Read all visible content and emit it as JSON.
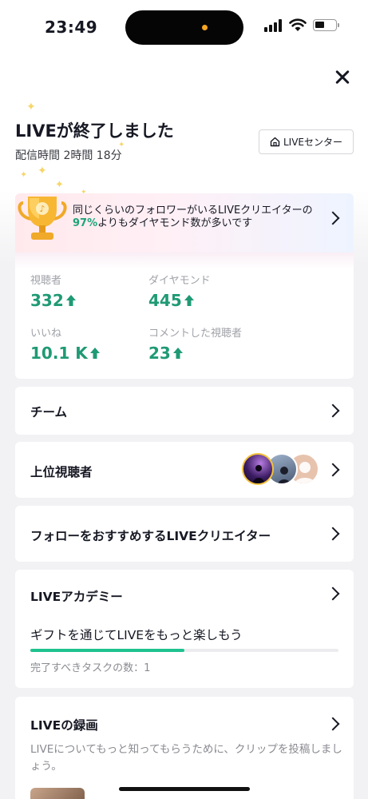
{
  "status_bar": {
    "time": "23:49"
  },
  "header": {
    "title": "LIVEが終了しました",
    "duration": "配信時間 2時間 18分",
    "live_center_label": "LIVEセンター"
  },
  "stats": {
    "banner_pre": "同じくらいのフォロワーがいるLIVEクリエイターの",
    "banner_pct": "97%",
    "banner_post": "よりもダイヤモンド数が多いです",
    "items": [
      {
        "label": "視聴者",
        "value": "332"
      },
      {
        "label": "ダイヤモンド",
        "value": "445"
      },
      {
        "label": "いいね",
        "value": "10.1 K"
      },
      {
        "label": "コメントした視聴者",
        "value": "23"
      }
    ]
  },
  "rows": {
    "team": "チーム",
    "top_viewers": "上位視聴者",
    "recommend": "フォローをおすすめするLIVEクリエイター"
  },
  "academy": {
    "title": "LIVEアカデミー",
    "task_title": "ギフトを通じてLIVEをもっと楽しもう",
    "progress": 0.5,
    "remaining": "完了すべきタスクの数：1"
  },
  "recording": {
    "title": "LIVEの録画",
    "description": "LIVEについてもっと知ってもらうために、クリップを投稿しましょう。"
  },
  "colors": {
    "accent_green": "#1f9a74",
    "progress_green": "#1fc28f",
    "banner_start": "#ffe9ec",
    "banner_end": "#eef4ff"
  }
}
